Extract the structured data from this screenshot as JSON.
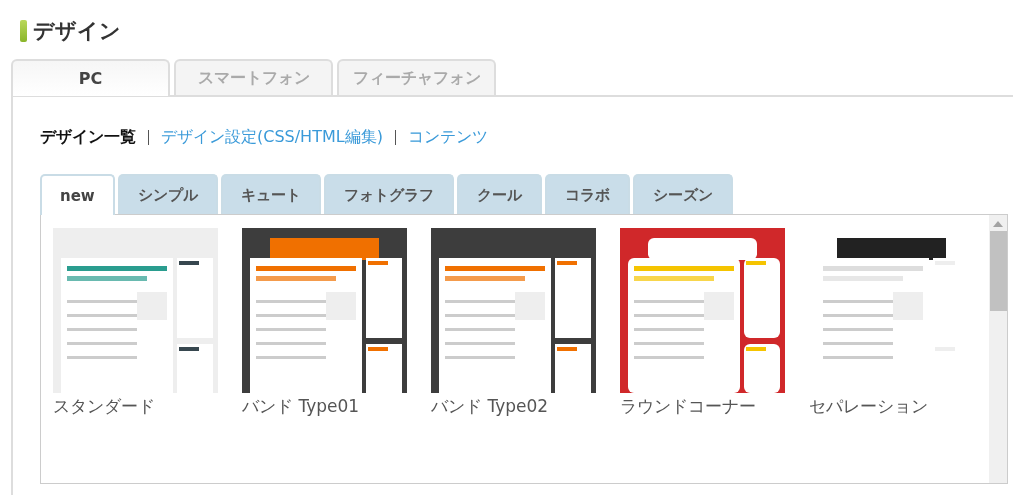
{
  "page_title": "デザイン",
  "device_tabs": [
    {
      "label": "PC",
      "selected": true
    },
    {
      "label": "スマートフォン",
      "selected": false
    },
    {
      "label": "フィーチャフォン",
      "selected": false
    }
  ],
  "sub_nav": [
    {
      "label": "デザイン一覧",
      "selected": true
    },
    {
      "label": "デザイン設定(CSS/HTML編集)",
      "selected": false
    },
    {
      "label": "コンテンツ",
      "selected": false
    }
  ],
  "category_tabs": [
    {
      "label": "new",
      "selected": true
    },
    {
      "label": "シンプル",
      "selected": false
    },
    {
      "label": "キュート",
      "selected": false
    },
    {
      "label": "フォトグラフ",
      "selected": false
    },
    {
      "label": "クール",
      "selected": false
    },
    {
      "label": "コラボ",
      "selected": false
    },
    {
      "label": "シーズン",
      "selected": false
    }
  ],
  "designs": [
    {
      "name": "スタンダード",
      "kind": "picture"
    },
    {
      "name": "バンド Type01",
      "kind": "picture"
    },
    {
      "name": "バンド Type02",
      "kind": "picture"
    },
    {
      "name": "ラウンドコーナー",
      "kind": "picture"
    },
    {
      "name": "セパレーション",
      "kind": "picture"
    }
  ]
}
